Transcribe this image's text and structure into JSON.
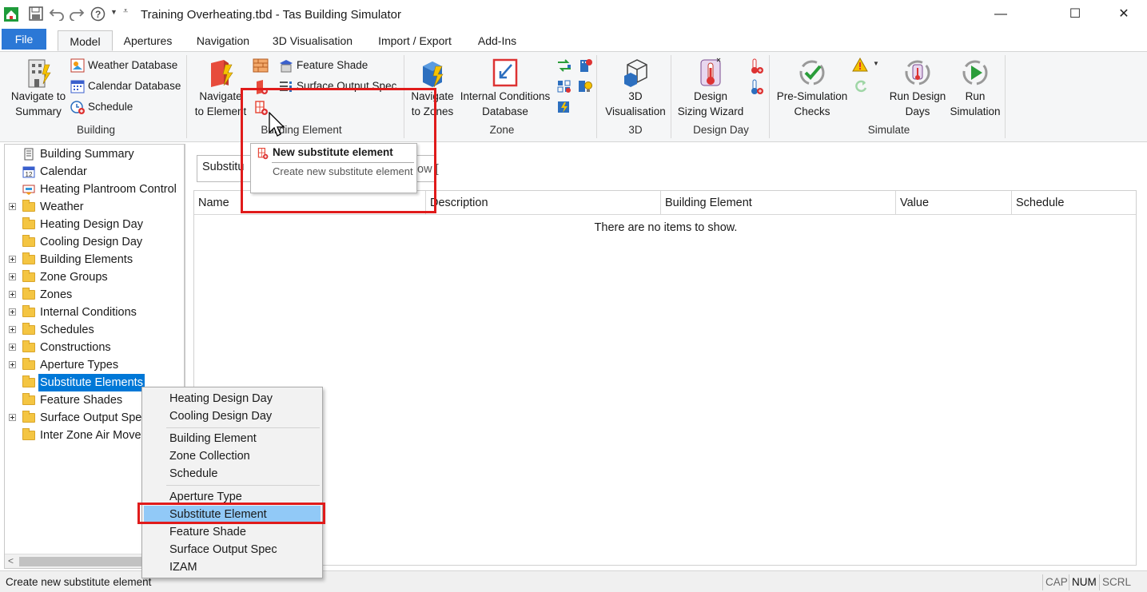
{
  "window": {
    "title": "Training Overheating.tbd - Tas Building Simulator",
    "minimize_glyph": "—",
    "maximize_glyph": "☐",
    "close_glyph": "✕"
  },
  "quick_access": [
    "app-icon",
    "save-icon",
    "undo-icon",
    "redo-icon",
    "help-icon",
    "dropdown-icon",
    "customize-icon"
  ],
  "tabs": {
    "file": "File",
    "items": [
      "Model",
      "Apertures",
      "Navigation",
      "3D Visualisation",
      "Import / Export",
      "Add-Ins"
    ],
    "active": "Model"
  },
  "ribbon": {
    "building": {
      "label": "Building",
      "navigate": "Navigate to\nSummary",
      "navigate_l1": "Navigate to",
      "navigate_l2": "Summary",
      "weather_db": "Weather Database",
      "calendar_db": "Calendar Database",
      "schedule": "Schedule"
    },
    "building_element": {
      "label": "Building Element",
      "navigate_l1": "Navigate",
      "navigate_l2": "to Element",
      "feature_shade": "Feature Shade",
      "surface_output": "Surface Output Spec"
    },
    "zone": {
      "label": "Zone",
      "navigate_l1": "Navigate",
      "navigate_l2": "to Zones",
      "ic_db_l1": "Internal Conditions",
      "ic_db_l2": "Database"
    },
    "view3d": {
      "label": "3D",
      "btn_l1": "3D",
      "btn_l2": "Visualisation"
    },
    "design_day": {
      "label": "Design Day",
      "btn_l1": "Design",
      "btn_l2": "Sizing Wizard"
    },
    "simulate": {
      "label": "Simulate",
      "presim_l1": "Pre-Simulation",
      "presim_l2": "Checks",
      "rundd_l1": "Run Design",
      "rundd_l2": "Days",
      "run_l1": "Run",
      "run_l2": "Simulation"
    }
  },
  "tooltip": {
    "title": "New substitute element",
    "description": "Create new substitute element"
  },
  "tree": {
    "items": [
      {
        "label": "Building Summary",
        "type": "doc",
        "expandable": false
      },
      {
        "label": "Calendar",
        "type": "calendar",
        "expandable": false
      },
      {
        "label": "Heating Plantroom Control",
        "type": "plant",
        "expandable": false
      },
      {
        "label": "Weather",
        "type": "folder",
        "expandable": true
      },
      {
        "label": "Heating Design Day",
        "type": "folder",
        "expandable": false
      },
      {
        "label": "Cooling Design Day",
        "type": "folder",
        "expandable": false
      },
      {
        "label": "Building Elements",
        "type": "folder",
        "expandable": true
      },
      {
        "label": "Zone Groups",
        "type": "folder",
        "expandable": true
      },
      {
        "label": "Zones",
        "type": "folder",
        "expandable": true
      },
      {
        "label": "Internal Conditions",
        "type": "folder",
        "expandable": true
      },
      {
        "label": "Schedules",
        "type": "folder",
        "expandable": true
      },
      {
        "label": "Constructions",
        "type": "folder",
        "expandable": true
      },
      {
        "label": "Aperture Types",
        "type": "folder",
        "expandable": true
      },
      {
        "label": "Substitute Elements",
        "type": "folder",
        "expandable": false,
        "selected": true
      },
      {
        "label": "Feature Shades",
        "type": "folder",
        "expandable": false
      },
      {
        "label": "Surface Output Spec",
        "type": "folder",
        "expandable": true
      },
      {
        "label": "Inter Zone Air Movement",
        "type": "folder",
        "expandable": false
      }
    ]
  },
  "rightpane": {
    "combo_value": "Substitu",
    "show_text": "ow [",
    "columns": [
      "Name",
      "Description",
      "Building Element",
      "Value",
      "Schedule"
    ],
    "empty_message": "There are no items to show."
  },
  "context_menu": {
    "groups": [
      [
        "Heating Design Day",
        "Cooling Design Day"
      ],
      [
        "Building Element",
        "Zone Collection",
        "Schedule"
      ],
      [
        "Aperture Type",
        "Substitute Element",
        "Feature Shade",
        "Surface Output Spec",
        "IZAM"
      ]
    ],
    "highlighted": "Substitute Element"
  },
  "status": {
    "text": "Create new substitute element",
    "cap": "CAP",
    "num": "NUM",
    "scrl": "SCRL"
  },
  "colors": {
    "accent": "#2b78d6",
    "selection": "#0078d7",
    "menu_highlight": "#91c9f7",
    "annotation_red": "#e01b1b"
  }
}
